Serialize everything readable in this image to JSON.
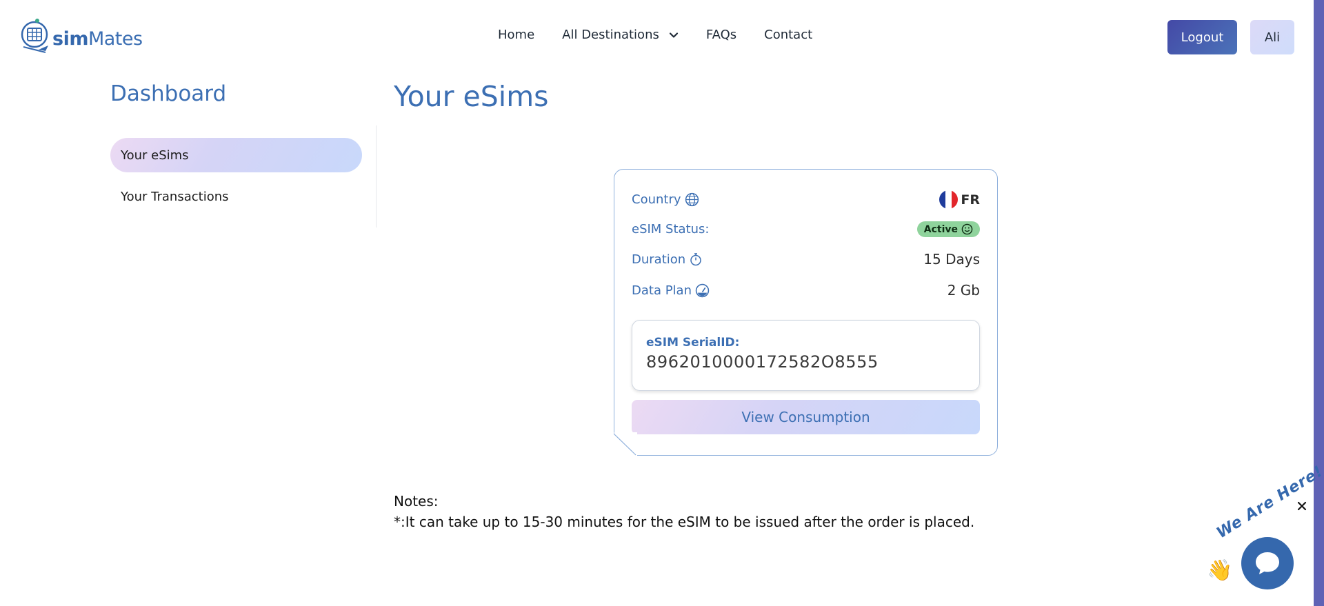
{
  "brand": {
    "name_part1": "sim",
    "name_part2": "Mates"
  },
  "nav": {
    "home": "Home",
    "destinations": "All Destinations",
    "faqs": "FAQs",
    "contact": "Contact"
  },
  "header": {
    "logout_label": "Logout",
    "user_label": "Ali"
  },
  "sidebar": {
    "title": "Dashboard",
    "items": [
      {
        "label": "Your eSims",
        "active": true
      },
      {
        "label": "Your Transactions",
        "active": false
      }
    ]
  },
  "main": {
    "title": "Your eSims",
    "esim": {
      "country_label": "Country",
      "country_value": "FR",
      "status_label": "eSIM Status:",
      "status_value": "Active",
      "duration_label": "Duration",
      "duration_value": "15 Days",
      "data_label": "Data Plan",
      "data_value": "2 Gb",
      "serial_label": "eSIM SerialID:",
      "serial_value": "8962010000172582O8555",
      "view_button": "View Consumption"
    },
    "notes_title": "Notes:",
    "notes_text": "*:It can take up to 15-30 minutes for the eSIM to be issued after the order is placed."
  },
  "chat": {
    "label": "We Are Here!"
  },
  "colors": {
    "brand_blue": "#3c6fb3",
    "status_green": "#8fd39c",
    "logout_bg": "#4449a6"
  },
  "icons": [
    "globe-icon",
    "smile-icon",
    "stopwatch-icon",
    "gauge-icon",
    "chevron-down-icon",
    "chat-icon",
    "close-icon",
    "wave-hand-icon",
    "france-flag-icon"
  ]
}
